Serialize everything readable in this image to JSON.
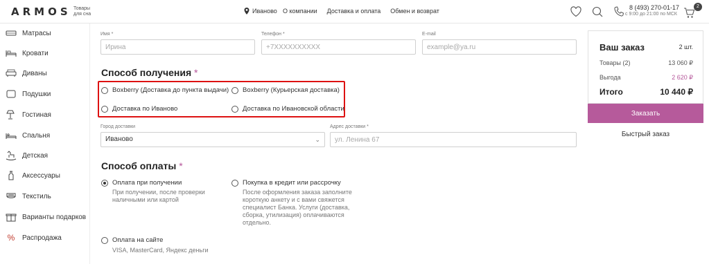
{
  "header": {
    "logo": "ARMOS",
    "logo_sub_1": "Товары",
    "logo_sub_2": "для сна",
    "city": "Иваново",
    "nav": [
      "О компании",
      "Доставка и оплата",
      "Обмен и возврат"
    ],
    "phone": "8 (493) 270-01-17",
    "hours": "с 9:00 до 21:00 по МСК",
    "cart_count": "2"
  },
  "sidebar": {
    "items": [
      {
        "label": "Матрасы",
        "icon": "mattress-icon"
      },
      {
        "label": "Кровати",
        "icon": "bed-icon"
      },
      {
        "label": "Диваны",
        "icon": "sofa-icon"
      },
      {
        "label": "Подушки",
        "icon": "pillow-icon"
      },
      {
        "label": "Гостиная",
        "icon": "lamp-icon"
      },
      {
        "label": "Спальня",
        "icon": "bedroom-icon"
      },
      {
        "label": "Детская",
        "icon": "rocking-horse-icon"
      },
      {
        "label": "Аксессуары",
        "icon": "bottle-icon"
      },
      {
        "label": "Текстиль",
        "icon": "towel-icon"
      },
      {
        "label": "Варианты подарков",
        "icon": "gift-icon"
      },
      {
        "label": "Распродажа",
        "icon": "percent-icon"
      }
    ]
  },
  "contact": {
    "name_label": "Имя *",
    "name_placeholder": "Ирина",
    "phone_label": "Телефон *",
    "phone_placeholder": "+7XXXXXXXXXX",
    "email_label": "E-mail",
    "email_placeholder": "example@ya.ru"
  },
  "delivery": {
    "title": "Способ получения",
    "req": "*",
    "options": [
      "Boxberry (Доставка до пункта выдачи)",
      "Boxberry (Курьерская доставка)",
      "Доставка по Иваново",
      "Доставка по Ивановской области"
    ],
    "city_label": "Город доставки",
    "city_value": "Иваново",
    "address_label": "Адрес доставки *",
    "address_placeholder": "ул. Ленина 67"
  },
  "payment": {
    "title": "Способ оплаты",
    "req": "*",
    "opt1_label": "Оплата при получении",
    "opt1_desc_1": "При получении, после проверки",
    "opt1_desc_2": "наличными или картой",
    "opt2_label": "Покупка в кредит или рассрочку",
    "opt2_desc": [
      "После оформления заказа заполните",
      "короткую анкету и с вами свяжется",
      "специалист Банка. Услуги (доставка,",
      "сборка, утилизация) оплачиваются",
      "отдельно."
    ],
    "opt3_label": "Оплата на сайте",
    "opt3_desc": "VISA, MasterCard, Яндекс деньги"
  },
  "summary": {
    "title": "Ваш заказ",
    "qty": "2 шт.",
    "goods_label": "Товары (2)",
    "goods_value": "13 060 ₽",
    "benefit_label": "Выгода",
    "benefit_value": "2 620 ₽",
    "total_label": "Итого",
    "total_value": "10 440 ₽",
    "order_button": "Заказать",
    "quick_order": "Быстрый заказ"
  },
  "colors": {
    "accent": "#b65a9b",
    "highlight": "#dd1111"
  }
}
